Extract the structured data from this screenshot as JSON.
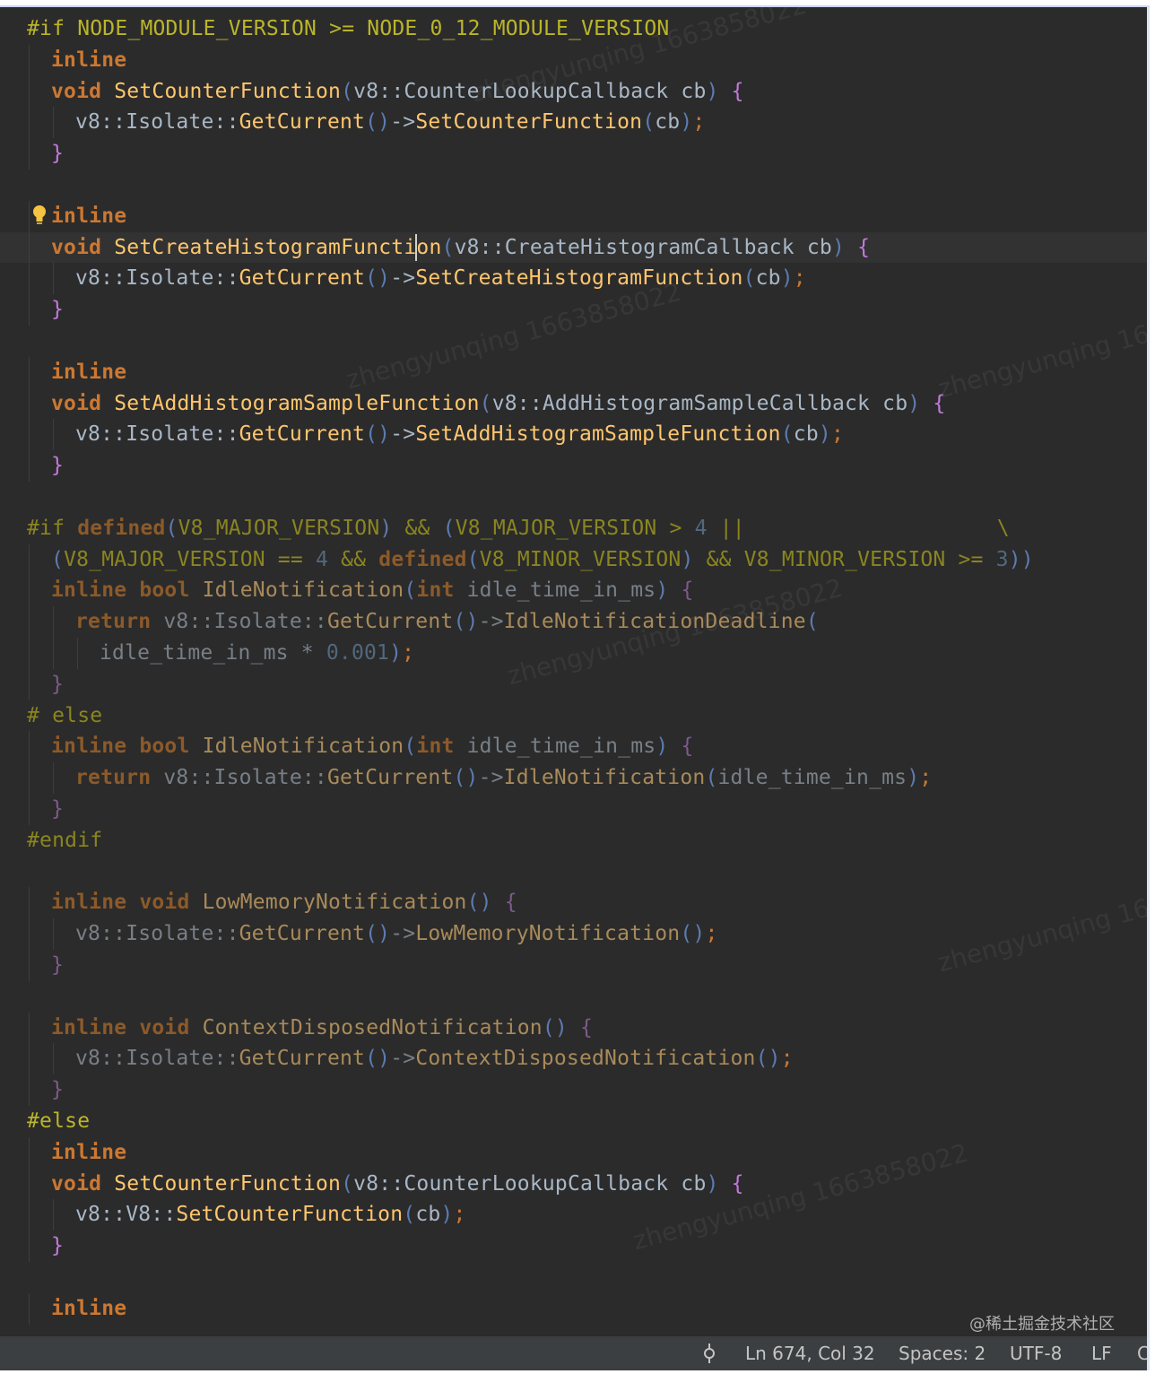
{
  "editor": {
    "lines": [
      [
        [
          "pp",
          "#if "
        ],
        [
          "pp",
          "NODE_MODULE_VERSION >= NODE_0_12_MODULE_VERSION"
        ]
      ],
      [
        [
          "kw",
          "inline"
        ]
      ],
      [
        [
          "kw",
          "void "
        ],
        [
          "fn",
          "SetCounterFunction"
        ],
        [
          "paren",
          "("
        ],
        [
          "id",
          "v8::CounterLookupCallback cb"
        ],
        [
          "paren",
          ") "
        ],
        [
          "brace",
          "{"
        ]
      ],
      [
        [
          "id",
          "v8::Isolate::"
        ],
        [
          "fn",
          "GetCurrent"
        ],
        [
          "paren",
          "()"
        ],
        [
          "id",
          "->"
        ],
        [
          "fn",
          "SetCounterFunction"
        ],
        [
          "paren",
          "("
        ],
        [
          "id",
          "cb"
        ],
        [
          "paren",
          ")"
        ],
        [
          "semi",
          ";"
        ]
      ],
      [
        [
          "brace",
          "}"
        ]
      ],
      [],
      [
        [
          "kw",
          "inline"
        ]
      ],
      [
        [
          "kw",
          "void "
        ],
        [
          "fn",
          "SetCreateHistogramFuncti"
        ],
        [
          "cursor",
          ""
        ],
        [
          "fn",
          "on"
        ],
        [
          "paren",
          "("
        ],
        [
          "id",
          "v8::CreateHistogramCallback cb"
        ],
        [
          "paren",
          ") "
        ],
        [
          "brace",
          "{"
        ]
      ],
      [
        [
          "id",
          "v8::Isolate::"
        ],
        [
          "fn",
          "GetCurrent"
        ],
        [
          "paren",
          "()"
        ],
        [
          "id",
          "->"
        ],
        [
          "fn",
          "SetCreateHistogramFunction"
        ],
        [
          "paren",
          "("
        ],
        [
          "id",
          "cb"
        ],
        [
          "paren",
          ")"
        ],
        [
          "semi",
          ";"
        ]
      ],
      [
        [
          "brace",
          "}"
        ]
      ],
      [],
      [
        [
          "kw",
          "inline"
        ]
      ],
      [
        [
          "kw",
          "void "
        ],
        [
          "fn",
          "SetAddHistogramSampleFunction"
        ],
        [
          "paren",
          "("
        ],
        [
          "id",
          "v8::AddHistogramSampleCallback cb"
        ],
        [
          "paren",
          ") "
        ],
        [
          "brace",
          "{"
        ]
      ],
      [
        [
          "id",
          "v8::Isolate::"
        ],
        [
          "fn",
          "GetCurrent"
        ],
        [
          "paren",
          "()"
        ],
        [
          "id",
          "->"
        ],
        [
          "fn",
          "SetAddHistogramSampleFunction"
        ],
        [
          "paren",
          "("
        ],
        [
          "id",
          "cb"
        ],
        [
          "paren",
          ")"
        ],
        [
          "semi",
          ";"
        ]
      ],
      [
        [
          "brace",
          "}"
        ]
      ],
      [],
      [
        [
          "pp",
          "#if "
        ],
        [
          "kw",
          "defined"
        ],
        [
          "paren",
          "("
        ],
        [
          "pp",
          "V8_MAJOR_VERSION"
        ],
        [
          "paren",
          ") "
        ],
        [
          "pp",
          "&& "
        ],
        [
          "paren",
          "("
        ],
        [
          "pp",
          "V8_MAJOR_VERSION > "
        ],
        [
          "num",
          "4"
        ],
        [
          "pp",
          " ||                    \\"
        ]
      ],
      [
        [
          "paren",
          "("
        ],
        [
          "pp",
          "V8_MAJOR_VERSION == "
        ],
        [
          "num",
          "4"
        ],
        [
          "pp",
          " && "
        ],
        [
          "kw",
          "defined"
        ],
        [
          "paren",
          "("
        ],
        [
          "pp",
          "V8_MINOR_VERSION"
        ],
        [
          "paren",
          ") "
        ],
        [
          "pp",
          "&& V8_MINOR_VERSION >= "
        ],
        [
          "num",
          "3"
        ],
        [
          "paren",
          "))"
        ]
      ],
      [
        [
          "kw",
          "inline bool "
        ],
        [
          "fn",
          "IdleNotification"
        ],
        [
          "paren",
          "("
        ],
        [
          "kw",
          "int "
        ],
        [
          "id",
          "idle_time_in_ms"
        ],
        [
          "paren",
          ") "
        ],
        [
          "brace",
          "{"
        ]
      ],
      [
        [
          "kw",
          "return "
        ],
        [
          "id",
          "v8::Isolate::"
        ],
        [
          "fn",
          "GetCurrent"
        ],
        [
          "paren",
          "()"
        ],
        [
          "id",
          "->"
        ],
        [
          "fn",
          "IdleNotificationDeadline"
        ],
        [
          "paren",
          "("
        ]
      ],
      [
        [
          "id",
          "idle_time_in_ms * "
        ],
        [
          "num",
          "0.001"
        ],
        [
          "paren",
          ")"
        ],
        [
          "semi",
          ";"
        ]
      ],
      [
        [
          "brace",
          "}"
        ]
      ],
      [
        [
          "pp",
          "# else"
        ]
      ],
      [
        [
          "kw",
          "inline bool "
        ],
        [
          "fn",
          "IdleNotification"
        ],
        [
          "paren",
          "("
        ],
        [
          "kw",
          "int "
        ],
        [
          "id",
          "idle_time_in_ms"
        ],
        [
          "paren",
          ") "
        ],
        [
          "brace",
          "{"
        ]
      ],
      [
        [
          "kw",
          "return "
        ],
        [
          "id",
          "v8::Isolate::"
        ],
        [
          "fn",
          "GetCurrent"
        ],
        [
          "paren",
          "()"
        ],
        [
          "id",
          "->"
        ],
        [
          "fn",
          "IdleNotification"
        ],
        [
          "paren",
          "("
        ],
        [
          "id",
          "idle_time_in_ms"
        ],
        [
          "paren",
          ")"
        ],
        [
          "semi",
          ";"
        ]
      ],
      [
        [
          "brace",
          "}"
        ]
      ],
      [
        [
          "pp",
          "#endif"
        ]
      ],
      [],
      [
        [
          "kw",
          "inline void "
        ],
        [
          "fn",
          "LowMemoryNotification"
        ],
        [
          "paren",
          "() "
        ],
        [
          "brace",
          "{"
        ]
      ],
      [
        [
          "id",
          "v8::Isolate::"
        ],
        [
          "fn",
          "GetCurrent"
        ],
        [
          "paren",
          "()"
        ],
        [
          "id",
          "->"
        ],
        [
          "fn",
          "LowMemoryNotification"
        ],
        [
          "paren",
          "()"
        ],
        [
          "semi",
          ";"
        ]
      ],
      [
        [
          "brace",
          "}"
        ]
      ],
      [],
      [
        [
          "kw",
          "inline void "
        ],
        [
          "fn",
          "ContextDisposedNotification"
        ],
        [
          "paren",
          "() "
        ],
        [
          "brace",
          "{"
        ]
      ],
      [
        [
          "id",
          "v8::Isolate::"
        ],
        [
          "fn",
          "GetCurrent"
        ],
        [
          "paren",
          "()"
        ],
        [
          "id",
          "->"
        ],
        [
          "fn",
          "ContextDisposedNotification"
        ],
        [
          "paren",
          "()"
        ],
        [
          "semi",
          ";"
        ]
      ],
      [
        [
          "brace",
          "}"
        ]
      ],
      [
        [
          "pp",
          "#else"
        ]
      ],
      [
        [
          "kw",
          "inline"
        ]
      ],
      [
        [
          "kw",
          "void "
        ],
        [
          "fn",
          "SetCounterFunction"
        ],
        [
          "paren",
          "("
        ],
        [
          "id",
          "v8::CounterLookupCallback cb"
        ],
        [
          "paren",
          ") "
        ],
        [
          "brace",
          "{"
        ]
      ],
      [
        [
          "id",
          "v8::V8::"
        ],
        [
          "fn",
          "SetCounterFunction"
        ],
        [
          "paren",
          "("
        ],
        [
          "id",
          "cb"
        ],
        [
          "paren",
          ")"
        ],
        [
          "semi",
          ";"
        ]
      ],
      [
        [
          "brace",
          "}"
        ]
      ],
      [],
      [
        [
          "kw",
          "inline"
        ]
      ]
    ],
    "indents": [
      0,
      1,
      1,
      2,
      1,
      0,
      1,
      1,
      2,
      1,
      0,
      1,
      1,
      2,
      1,
      0,
      0,
      1,
      1,
      2,
      3,
      1,
      0,
      1,
      2,
      1,
      0,
      0,
      1,
      2,
      1,
      0,
      1,
      2,
      1,
      0,
      1,
      1,
      2,
      1,
      0,
      1
    ],
    "dimmed": [
      false,
      false,
      false,
      false,
      false,
      false,
      false,
      false,
      false,
      false,
      false,
      false,
      false,
      false,
      false,
      false,
      true,
      true,
      true,
      true,
      true,
      true,
      true,
      true,
      true,
      true,
      true,
      false,
      true,
      true,
      true,
      false,
      true,
      true,
      true,
      false,
      false,
      false,
      false,
      false,
      false,
      false
    ],
    "current_line": 7,
    "lightbulb_line": 6
  },
  "watermarks": [
    "zhengyunqing 1663858022",
    "zhengyunqing 1663858022",
    "zhengyunqing 1663858022",
    "zhengyunqing 1663858022",
    "zhengyunqing 1663858022",
    "zhengyunqing 1663858022"
  ],
  "statusbar": {
    "icon": "git-commit-icon",
    "position": "Ln 674, Col 32",
    "spaces": "Spaces: 2",
    "encoding": "UTF-8",
    "eol": "LF",
    "trailing": "C"
  },
  "credit": "@稀土掘金技术社区"
}
